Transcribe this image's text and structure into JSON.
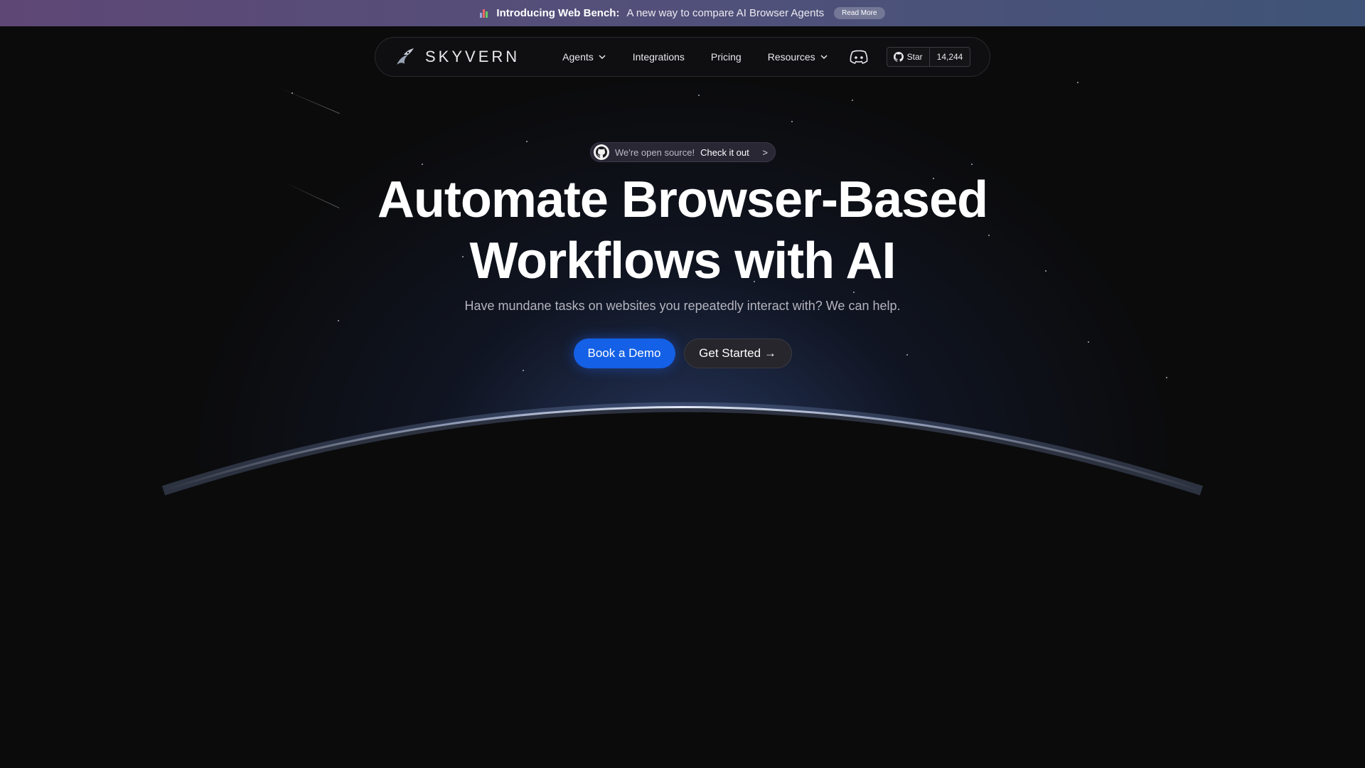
{
  "announcement": {
    "icon": "bar-chart-icon",
    "bold": "Introducing Web Bench:",
    "message": "A new way to compare AI Browser Agents",
    "read_more": "Read More"
  },
  "nav": {
    "brand": "SKYVERN",
    "items": [
      {
        "label": "Agents",
        "dropdown": true
      },
      {
        "label": "Integrations",
        "dropdown": false
      },
      {
        "label": "Pricing",
        "dropdown": false
      },
      {
        "label": "Resources",
        "dropdown": true
      }
    ],
    "discord_icon": "discord-icon",
    "github": {
      "label": "Star",
      "count": "14,244"
    }
  },
  "hero": {
    "pill_text": "We're open source!",
    "pill_cta": "Check it out",
    "pill_arrow": ">",
    "headline_line1": "Automate Browser-Based",
    "headline_line2": "Workflows with AI",
    "subhead": "Have mundane tasks on websites you repeatedly interact with? We can help.",
    "primary_button": "Book a Demo",
    "secondary_button": "Get Started →"
  },
  "colors": {
    "background": "#0b0b0c",
    "accent": "#1460e6",
    "banner_start": "#5e4775",
    "banner_end": "#3f5478"
  }
}
